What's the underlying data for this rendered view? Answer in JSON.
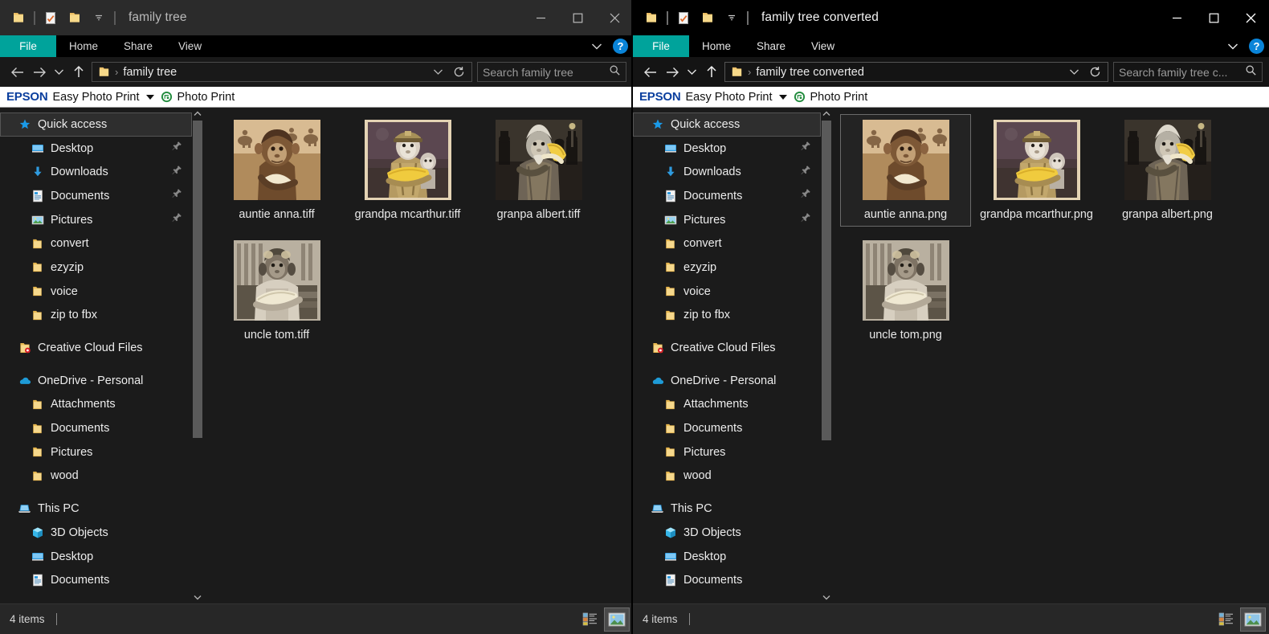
{
  "left_window": {
    "title": "family tree",
    "active": false,
    "quick_access_icons": [
      "folder-icon",
      "properties-icon",
      "new-folder-icon",
      "customize-chevron-icon"
    ],
    "window_controls": {
      "minimize": "minimize-icon",
      "maximize": "maximize-icon",
      "close": "close-icon"
    },
    "ribbon": {
      "file_tab": "File",
      "tabs": [
        "Home",
        "Share",
        "View"
      ],
      "collapse": "chevron-down-icon",
      "help": "?"
    },
    "address": {
      "back": "back-arrow-icon",
      "forward": "forward-arrow-icon",
      "recent": "chevron-down-icon",
      "up": "up-arrow-icon",
      "breadcrumb": "family tree",
      "dropdown": "chevron-down-icon",
      "refresh": "refresh-icon"
    },
    "search": {
      "placeholder": "Search family tree",
      "icon": "search-icon"
    },
    "epson": {
      "logo": "EPSON",
      "app": "Easy Photo Print",
      "caret": "caret-down-icon",
      "globe": "epson-globe-icon",
      "action": "Photo Print"
    },
    "sidebar": {
      "sections": [
        {
          "header": {
            "label": "Quick access",
            "icon": "star-icon",
            "selected": true
          },
          "items": [
            {
              "label": "Desktop",
              "icon": "desktop-icon",
              "pinned": true
            },
            {
              "label": "Downloads",
              "icon": "download-icon",
              "pinned": true
            },
            {
              "label": "Documents",
              "icon": "documents-icon",
              "pinned": true
            },
            {
              "label": "Pictures",
              "icon": "pictures-icon",
              "pinned": true
            },
            {
              "label": "convert",
              "icon": "folder-icon",
              "pinned": false
            },
            {
              "label": "ezyzip",
              "icon": "folder-icon",
              "pinned": false
            },
            {
              "label": "voice",
              "icon": "folder-icon",
              "pinned": false
            },
            {
              "label": "zip to fbx",
              "icon": "folder-icon",
              "pinned": false
            }
          ]
        },
        {
          "header": {
            "label": "Creative Cloud Files",
            "icon": "creative-cloud-icon",
            "selected": false
          },
          "items": []
        },
        {
          "header": {
            "label": "OneDrive - Personal",
            "icon": "onedrive-icon",
            "selected": false
          },
          "items": [
            {
              "label": "Attachments",
              "icon": "folder-icon",
              "pinned": false
            },
            {
              "label": "Documents",
              "icon": "folder-icon",
              "pinned": false
            },
            {
              "label": "Pictures",
              "icon": "folder-icon",
              "pinned": false
            },
            {
              "label": "wood",
              "icon": "folder-icon",
              "pinned": false
            }
          ]
        },
        {
          "header": {
            "label": "This PC",
            "icon": "thispc-icon",
            "selected": false
          },
          "items": [
            {
              "label": "3D Objects",
              "icon": "3dobjects-icon",
              "pinned": false
            },
            {
              "label": "Desktop",
              "icon": "desktop-icon",
              "pinned": false
            },
            {
              "label": "Documents",
              "icon": "documents-icon",
              "pinned": false
            }
          ]
        }
      ],
      "scroll_up": "chevron-up-icon",
      "scroll_down": "chevron-down-icon"
    },
    "files": [
      {
        "name": "auntie anna.tiff",
        "thumb": "sepia-ape-horses",
        "selected": false
      },
      {
        "name": "grandpa mcarthur.tiff",
        "thumb": "officer-monkey-banana",
        "selected": false
      },
      {
        "name": "granpa albert.tiff",
        "thumb": "elder-monkey-banana",
        "selected": false
      },
      {
        "name": "uncle tom.tiff",
        "thumb": "aviator-monkey-banana",
        "selected": false
      }
    ],
    "status": {
      "count": "4 items",
      "view_details": "details-view-icon",
      "view_large": "large-icons-view-icon",
      "active_view": "large"
    }
  },
  "right_window": {
    "title": "family tree converted",
    "active": true,
    "quick_access_icons": [
      "folder-icon",
      "properties-icon",
      "new-folder-icon",
      "customize-chevron-icon"
    ],
    "window_controls": {
      "minimize": "minimize-icon",
      "maximize": "maximize-icon",
      "close": "close-icon"
    },
    "ribbon": {
      "file_tab": "File",
      "tabs": [
        "Home",
        "Share",
        "View"
      ],
      "collapse": "chevron-down-icon",
      "help": "?"
    },
    "address": {
      "back": "back-arrow-icon",
      "forward": "forward-arrow-icon",
      "recent": "chevron-down-icon",
      "up": "up-arrow-icon",
      "breadcrumb": "family tree converted",
      "dropdown": "chevron-down-icon",
      "refresh": "refresh-icon"
    },
    "search": {
      "placeholder": "Search family tree c...",
      "icon": "search-icon"
    },
    "epson": {
      "logo": "EPSON",
      "app": "Easy Photo Print",
      "caret": "caret-down-icon",
      "globe": "epson-globe-icon",
      "action": "Photo Print"
    },
    "sidebar": {
      "sections": [
        {
          "header": {
            "label": "Quick access",
            "icon": "star-icon",
            "selected": true
          },
          "items": [
            {
              "label": "Desktop",
              "icon": "desktop-icon",
              "pinned": true
            },
            {
              "label": "Downloads",
              "icon": "download-icon",
              "pinned": true
            },
            {
              "label": "Documents",
              "icon": "documents-icon",
              "pinned": true
            },
            {
              "label": "Pictures",
              "icon": "pictures-icon",
              "pinned": true
            },
            {
              "label": "convert",
              "icon": "folder-icon",
              "pinned": false
            },
            {
              "label": "ezyzip",
              "icon": "folder-icon",
              "pinned": false
            },
            {
              "label": "voice",
              "icon": "folder-icon",
              "pinned": false
            },
            {
              "label": "zip to fbx",
              "icon": "folder-icon",
              "pinned": false
            }
          ]
        },
        {
          "header": {
            "label": "Creative Cloud Files",
            "icon": "creative-cloud-icon",
            "selected": false
          },
          "items": []
        },
        {
          "header": {
            "label": "OneDrive - Personal",
            "icon": "onedrive-icon",
            "selected": false
          },
          "items": [
            {
              "label": "Attachments",
              "icon": "folder-icon",
              "pinned": false
            },
            {
              "label": "Documents",
              "icon": "folder-icon",
              "pinned": false
            },
            {
              "label": "Pictures",
              "icon": "folder-icon",
              "pinned": false
            },
            {
              "label": "wood",
              "icon": "folder-icon",
              "pinned": false
            }
          ]
        },
        {
          "header": {
            "label": "This PC",
            "icon": "thispc-icon",
            "selected": false
          },
          "items": [
            {
              "label": "3D Objects",
              "icon": "3dobjects-icon",
              "pinned": false
            },
            {
              "label": "Desktop",
              "icon": "desktop-icon",
              "pinned": false
            },
            {
              "label": "Documents",
              "icon": "documents-icon",
              "pinned": false
            }
          ]
        }
      ],
      "scroll_up": "chevron-up-icon",
      "scroll_down": "chevron-down-icon"
    },
    "files": [
      {
        "name": "auntie anna.png",
        "thumb": "sepia-ape-horses",
        "selected": true
      },
      {
        "name": "grandpa mcarthur.png",
        "thumb": "officer-monkey-banana",
        "selected": false
      },
      {
        "name": "granpa albert.png",
        "thumb": "elder-monkey-banana",
        "selected": false
      },
      {
        "name": "uncle tom.png",
        "thumb": "aviator-monkey-banana",
        "selected": false
      }
    ],
    "status": {
      "count": "4 items",
      "view_details": "details-view-icon",
      "view_large": "large-icons-view-icon",
      "active_view": "large"
    }
  },
  "colors": {
    "file_tab_teal": "#00a39b",
    "help_blue": "#0a84d8",
    "epson_blue": "#0b3f9e",
    "folder_yellow": "#f5cb5c",
    "accent_blue": "#2f9bdf",
    "selection_border": "#6a6a6a"
  }
}
